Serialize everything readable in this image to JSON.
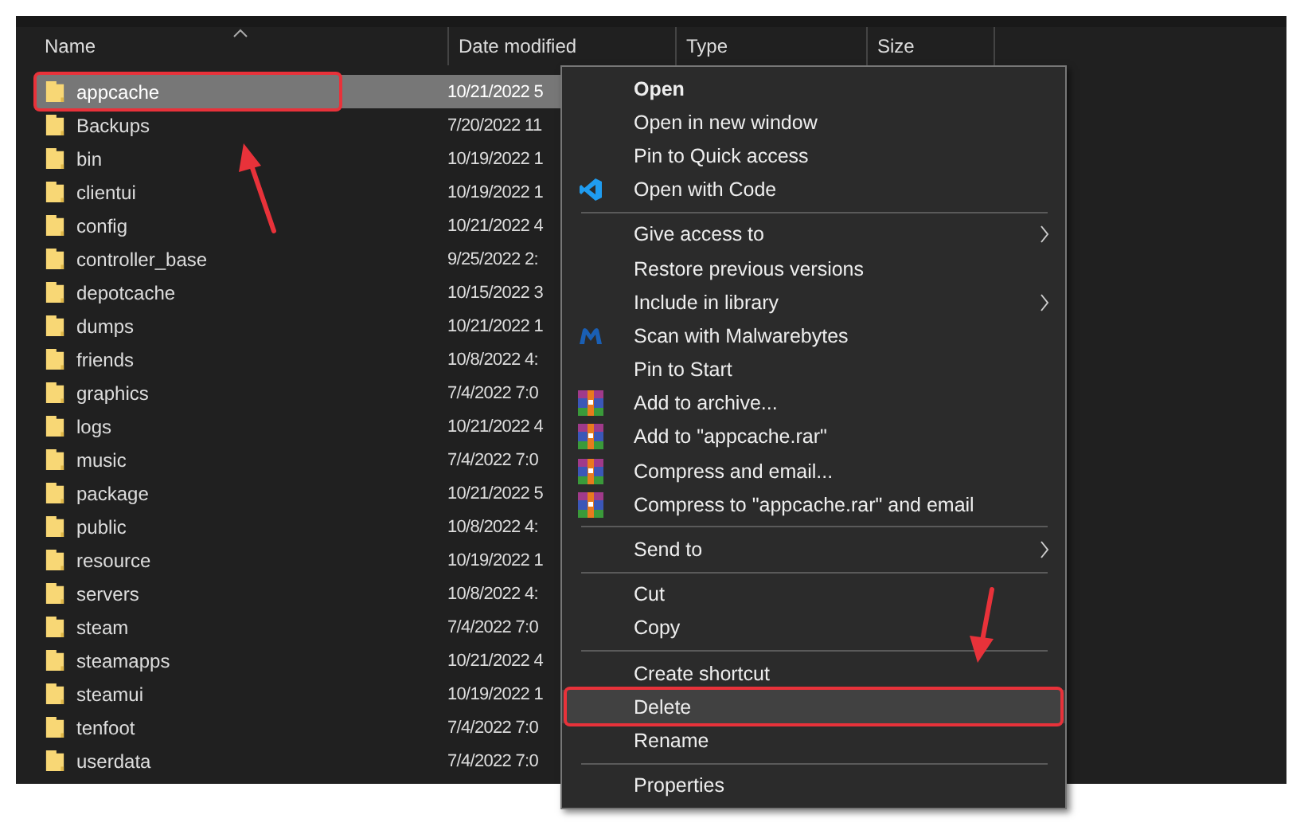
{
  "columns": [
    {
      "label": "Name",
      "sorted": true
    },
    {
      "label": "Date modified",
      "sorted": false
    },
    {
      "label": "Type",
      "sorted": false
    },
    {
      "label": "Size",
      "sorted": false
    }
  ],
  "rows": [
    {
      "name": "appcache",
      "date": "10/21/2022 5",
      "selected": true,
      "marked": true
    },
    {
      "name": "Backups",
      "date": "7/20/2022 11",
      "selected": false,
      "marked": false
    },
    {
      "name": "bin",
      "date": "10/19/2022 1",
      "selected": false,
      "marked": false
    },
    {
      "name": "clientui",
      "date": "10/19/2022 1",
      "selected": false,
      "marked": false
    },
    {
      "name": "config",
      "date": "10/21/2022 4",
      "selected": false,
      "marked": false
    },
    {
      "name": "controller_base",
      "date": "9/25/2022 2:",
      "selected": false,
      "marked": false
    },
    {
      "name": "depotcache",
      "date": "10/15/2022 3",
      "selected": false,
      "marked": false
    },
    {
      "name": "dumps",
      "date": "10/21/2022 1",
      "selected": false,
      "marked": false
    },
    {
      "name": "friends",
      "date": "10/8/2022 4:",
      "selected": false,
      "marked": false
    },
    {
      "name": "graphics",
      "date": "7/4/2022 7:0",
      "selected": false,
      "marked": false
    },
    {
      "name": "logs",
      "date": "10/21/2022 4",
      "selected": false,
      "marked": false
    },
    {
      "name": "music",
      "date": "7/4/2022 7:0",
      "selected": false,
      "marked": false
    },
    {
      "name": "package",
      "date": "10/21/2022 5",
      "selected": false,
      "marked": false
    },
    {
      "name": "public",
      "date": "10/8/2022 4:",
      "selected": false,
      "marked": false
    },
    {
      "name": "resource",
      "date": "10/19/2022 1",
      "selected": false,
      "marked": false
    },
    {
      "name": "servers",
      "date": "10/8/2022 4:",
      "selected": false,
      "marked": false
    },
    {
      "name": "steam",
      "date": "7/4/2022 7:0",
      "selected": false,
      "marked": false
    },
    {
      "name": "steamapps",
      "date": "10/21/2022 4",
      "selected": false,
      "marked": false
    },
    {
      "name": "steamui",
      "date": "10/19/2022 1",
      "selected": false,
      "marked": false
    },
    {
      "name": "tenfoot",
      "date": "7/4/2022 7:0",
      "selected": false,
      "marked": false
    },
    {
      "name": "userdata",
      "date": "7/4/2022 7:0",
      "selected": false,
      "marked": false
    }
  ],
  "context_menu": [
    {
      "kind": "plain",
      "label": "Open",
      "bold": true,
      "submenu": false,
      "selected": false,
      "marked": false
    },
    {
      "kind": "plain",
      "label": "Open in new window",
      "bold": false,
      "submenu": false,
      "selected": false,
      "marked": false
    },
    {
      "kind": "plain",
      "label": "Pin to Quick access",
      "bold": false,
      "submenu": false,
      "selected": false,
      "marked": false
    },
    {
      "kind": "code",
      "label": "Open with Code",
      "bold": false,
      "submenu": false,
      "selected": false,
      "marked": false
    },
    {
      "kind": "separator"
    },
    {
      "kind": "plain",
      "label": "Give access to",
      "bold": false,
      "submenu": true,
      "selected": false,
      "marked": false
    },
    {
      "kind": "plain",
      "label": "Restore previous versions",
      "bold": false,
      "submenu": false,
      "selected": false,
      "marked": false
    },
    {
      "kind": "plain",
      "label": "Include in library",
      "bold": false,
      "submenu": true,
      "selected": false,
      "marked": false
    },
    {
      "kind": "scan",
      "label": "Scan with Malwarebytes",
      "bold": false,
      "submenu": false,
      "selected": false,
      "marked": false
    },
    {
      "kind": "plain",
      "label": "Pin to Start",
      "bold": false,
      "submenu": false,
      "selected": false,
      "marked": false
    },
    {
      "kind": "archive",
      "label": "Add to archive...",
      "bold": false,
      "submenu": false,
      "selected": false,
      "marked": false
    },
    {
      "kind": "archive",
      "label": "Add to \"appcache.rar\"",
      "bold": false,
      "submenu": false,
      "selected": false,
      "marked": false
    },
    {
      "kind": "archive",
      "label": "Compress and email...",
      "bold": false,
      "submenu": false,
      "selected": false,
      "marked": false
    },
    {
      "kind": "archive",
      "label": "Compress to \"appcache.rar\" and email",
      "bold": false,
      "submenu": false,
      "selected": false,
      "marked": false
    },
    {
      "kind": "separator"
    },
    {
      "kind": "plain",
      "label": "Send to",
      "bold": false,
      "submenu": true,
      "selected": false,
      "marked": false
    },
    {
      "kind": "separator"
    },
    {
      "kind": "plain",
      "label": "Cut",
      "bold": false,
      "submenu": false,
      "selected": false,
      "marked": false
    },
    {
      "kind": "plain",
      "label": "Copy",
      "bold": false,
      "submenu": false,
      "selected": false,
      "marked": false
    },
    {
      "kind": "separator"
    },
    {
      "kind": "plain",
      "label": "Create shortcut",
      "bold": false,
      "submenu": false,
      "selected": false,
      "marked": false
    },
    {
      "kind": "plain",
      "label": "Delete",
      "bold": false,
      "submenu": false,
      "selected": true,
      "marked": true
    },
    {
      "kind": "plain",
      "label": "Rename",
      "bold": false,
      "submenu": false,
      "selected": false,
      "marked": false
    },
    {
      "kind": "separator"
    },
    {
      "kind": "plain",
      "label": "Properties",
      "bold": false,
      "submenu": false,
      "selected": false,
      "marked": false
    }
  ]
}
